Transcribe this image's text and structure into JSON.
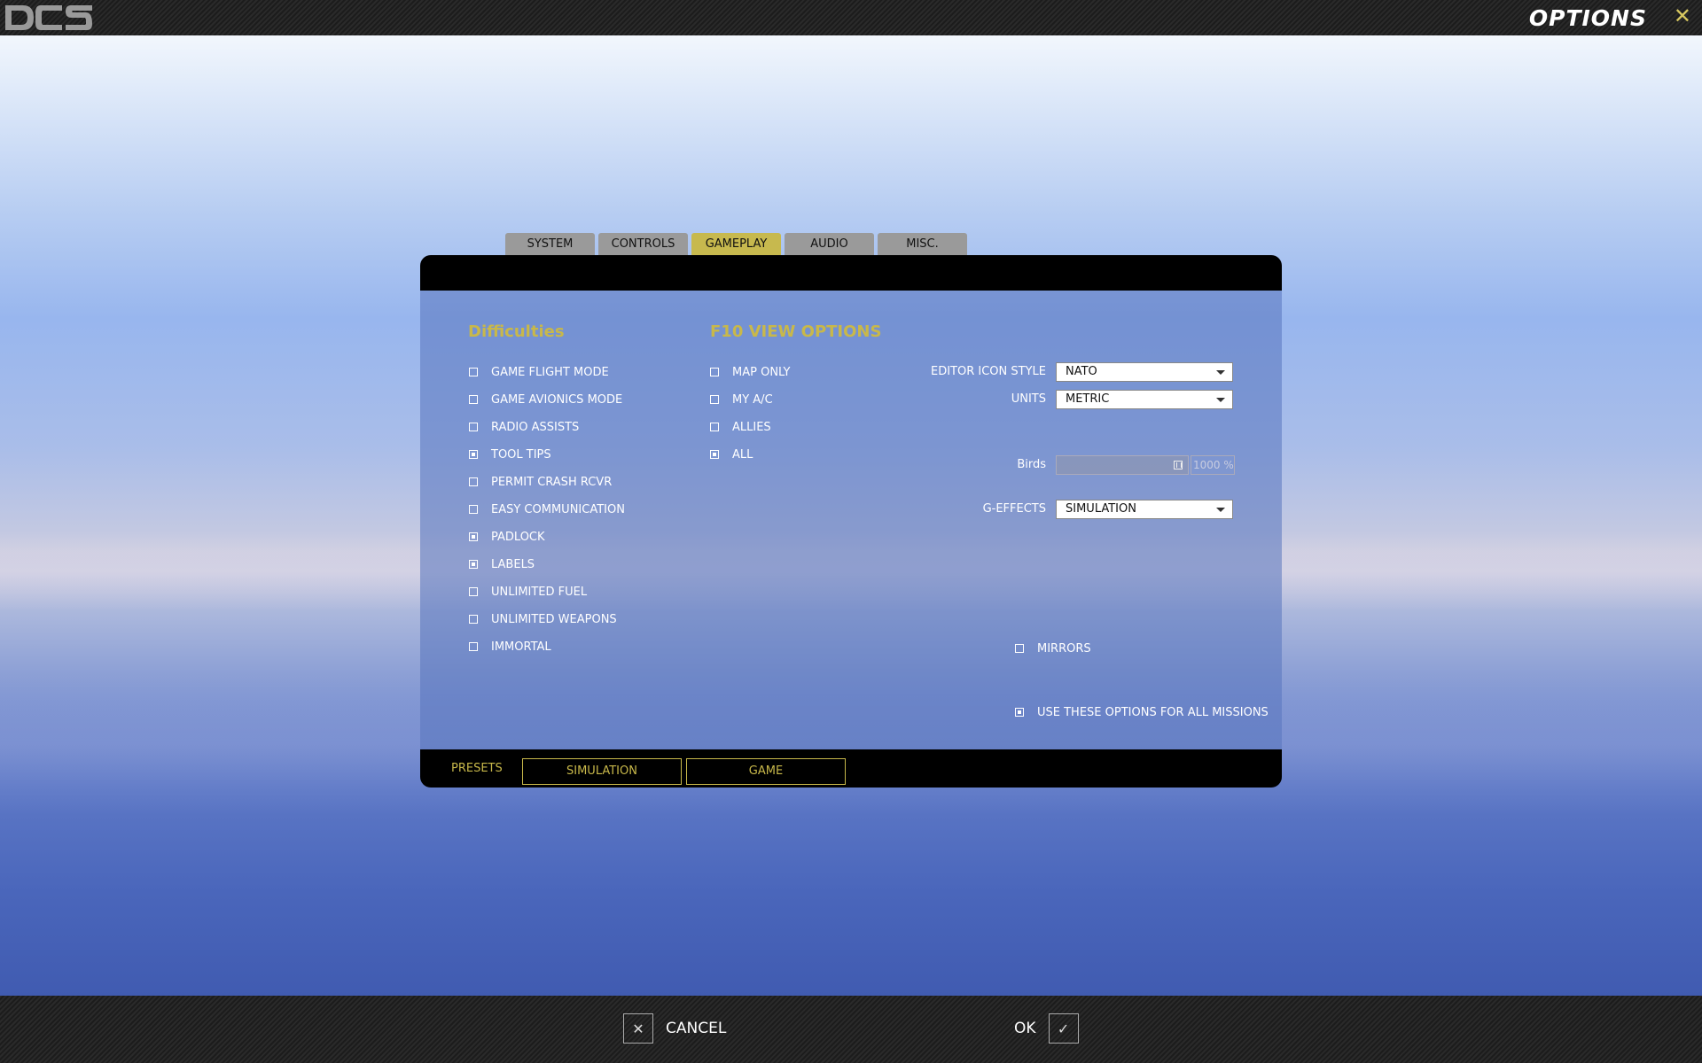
{
  "window": {
    "title": "OPTIONS",
    "close_glyph": "✕",
    "logo_name": "dcs-logo"
  },
  "tabs": [
    {
      "label": "SYSTEM",
      "active": false
    },
    {
      "label": "CONTROLS",
      "active": false
    },
    {
      "label": "GAMEPLAY",
      "active": true
    },
    {
      "label": "AUDIO",
      "active": false
    },
    {
      "label": "MISC.",
      "active": false
    }
  ],
  "difficulties": {
    "title": "Difficulties",
    "items": [
      {
        "label": "GAME FLIGHT MODE",
        "checked": false
      },
      {
        "label": "GAME AVIONICS MODE",
        "checked": false
      },
      {
        "label": "RADIO ASSISTS",
        "checked": false
      },
      {
        "label": "TOOL TIPS",
        "checked": true
      },
      {
        "label": "PERMIT CRASH RCVR",
        "checked": false
      },
      {
        "label": "EASY COMMUNICATION",
        "checked": false
      },
      {
        "label": "PADLOCK",
        "checked": true
      },
      {
        "label": "LABELS",
        "checked": true
      },
      {
        "label": "UNLIMITED FUEL",
        "checked": false
      },
      {
        "label": "UNLIMITED WEAPONS",
        "checked": false
      },
      {
        "label": "IMMORTAL",
        "checked": false
      }
    ]
  },
  "f10": {
    "title": "F10 VIEW OPTIONS",
    "items": [
      {
        "label": "MAP ONLY",
        "checked": false
      },
      {
        "label": "MY A/C",
        "checked": false
      },
      {
        "label": "ALLIES",
        "checked": false
      },
      {
        "label": "ALL",
        "checked": true
      }
    ]
  },
  "settings": {
    "editor_icon_style": {
      "label": "EDITOR ICON STYLE",
      "value": "NATO"
    },
    "units": {
      "label": "UNITS",
      "value": "METRIC"
    },
    "birds": {
      "label": "Birds",
      "value": "1000 %"
    },
    "g_effects": {
      "label": "G-EFFECTS",
      "value": "SIMULATION"
    },
    "mirrors": {
      "label": "MIRRORS",
      "checked": false
    },
    "use_for_all": {
      "label": "USE THESE OPTIONS FOR ALL MISSIONS",
      "checked": true
    }
  },
  "presets": {
    "label": "PRESETS",
    "buttons": [
      "SIMULATION",
      "GAME"
    ]
  },
  "bottom": {
    "cancel_label": "CANCEL",
    "cancel_glyph": "✕",
    "ok_label": "OK",
    "ok_glyph": "✓"
  },
  "colors": {
    "accent": "#c8b84a",
    "active_tab": "#c7b94e",
    "inactive_tab": "#9a9a9a"
  }
}
